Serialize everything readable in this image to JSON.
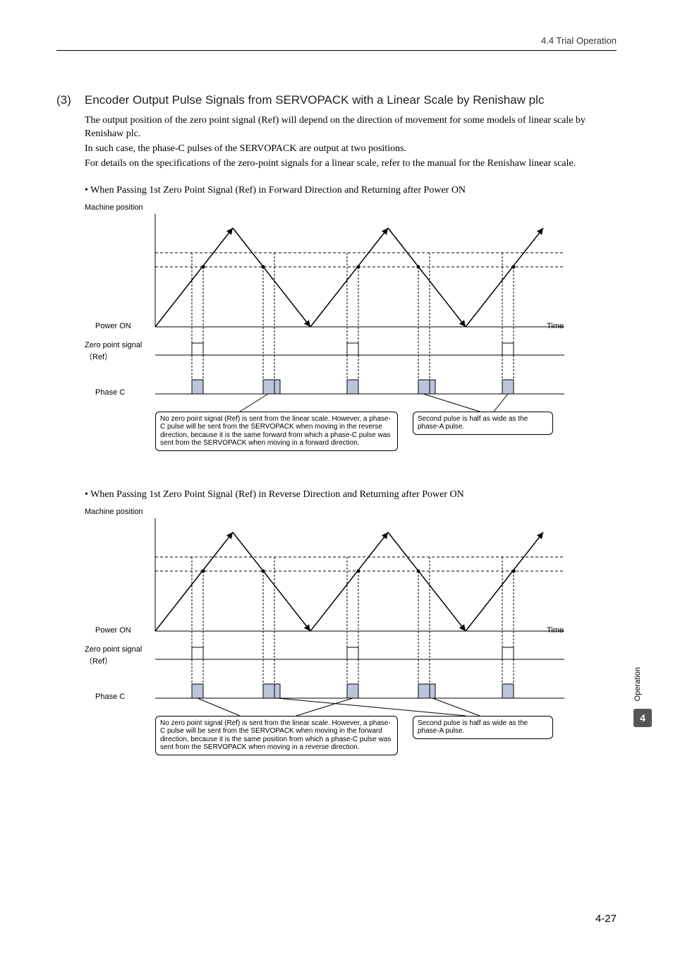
{
  "header": {
    "breadcrumb": "4.4  Trial Operation"
  },
  "section": {
    "number": "(3)",
    "title": "Encoder Output Pulse Signals from SERVOPACK with a Linear Scale by Renishaw plc",
    "para1": "The output position of the zero point signal (Ref) will depend on the direction of movement for some models of linear scale by Renishaw plc.",
    "para2": "In such case, the phase-C pulses of the SERVOPACK are output at two positions.",
    "para3": "For details on the specifications of the zero-point signals for a linear scale, refer to the manual for the Renishaw linear scale."
  },
  "case1": {
    "bullet": "• When Passing 1st Zero Point Signal (Ref) in Forward Direction and Returning after Power ON",
    "labels": {
      "machine_position": "Machine position",
      "power_on": "Power ON",
      "time": "Time",
      "zero_point": "Zero point signal",
      "zero_point_sub": "（Ref）",
      "phase_c": "Phase C"
    },
    "callout_left": "No zero point signal (Ref) is sent from the linear scale. However, a phase-C pulse will be sent from the SERVOPACK when moving in the reverse direction, because it is the same forward from which a phase-C pulse was sent from the SERVOPACK when moving in a forward direction.",
    "callout_right": "Second pulse is half as wide as the phase-A pulse."
  },
  "case2": {
    "bullet": "• When Passing 1st Zero Point Signal (Ref) in Reverse Direction and Returning after Power ON",
    "labels": {
      "machine_position": "Machine position",
      "power_on": "Power ON",
      "time": "Time",
      "zero_point": "Zero point signal",
      "zero_point_sub": "（Ref）",
      "phase_c": "Phase C"
    },
    "callout_left": "No zero point signal (Ref) is sent from the linear scale. However, a phase-C pulse will be sent from the SERVOPACK when moving in the forward direction, because it is the same position from which a phase-C pulse was sent from the SERVOPACK when moving in a reverse direction.",
    "callout_right": "Second pulse is half as wide as the phase-A pulse."
  },
  "side": {
    "label": "Operation",
    "chapter": "4"
  },
  "footer": {
    "page": "4-27"
  }
}
